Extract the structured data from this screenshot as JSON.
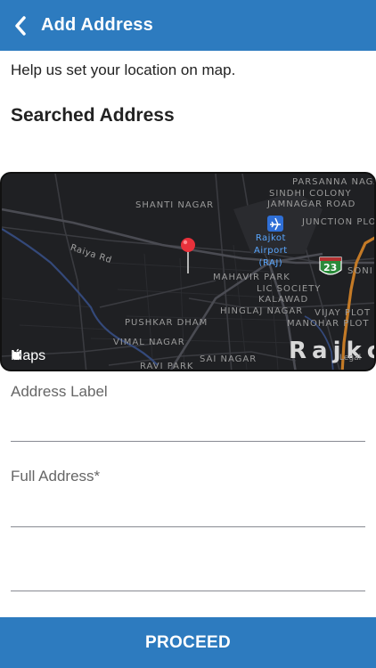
{
  "header": {
    "back_icon": "chevron-left-icon",
    "title": "Add Address"
  },
  "helper_text": "Help us set your location on map.",
  "section_title": "Searched Address",
  "map": {
    "labels": {
      "parsanna": "PARSANNA NAGA",
      "sindhi": "SINDHI COLONY",
      "jamnagar": "JAMNAGAR ROAD",
      "shanti": "SHANTI NAGAR",
      "junction": "JUNCTION PLO",
      "airport_1": "Rajkot",
      "airport_2": "Airport",
      "airport_3": "(RAJ)",
      "raiya": "Raiya Rd",
      "soni": "SONI",
      "mahavir": "MAHAVIR PARK",
      "lic": "LIC SOCIETY",
      "kalawad": "KALAWAD",
      "hinglaj": "HINGLAJ NAGAR",
      "vijay": "VIJAY PLOT",
      "pushkar": "PUSHKAR DHAM",
      "manohar": "MANOHAR PLOT",
      "vimal": "VIMAL NAGAR",
      "ravi": "RAVI PARK",
      "sai": "SAI NAGAR",
      "city": "Rajkc",
      "legal": "Legal",
      "highway": "23"
    },
    "brand": "Maps",
    "icons": [
      "map-pin-icon",
      "airport-icon",
      "highway-shield-icon",
      "apple-logo-icon"
    ]
  },
  "fields": {
    "address_label": {
      "label": "Address Label",
      "value": ""
    },
    "full_address": {
      "label": "Full Address*",
      "value": ""
    },
    "extra": {
      "value": ""
    }
  },
  "proceed_label": "PROCEED",
  "colors": {
    "primary": "#2d7bbf",
    "map_bg": "#1f2023",
    "pin": "#e8313b",
    "airport": "#5aa7ff"
  }
}
